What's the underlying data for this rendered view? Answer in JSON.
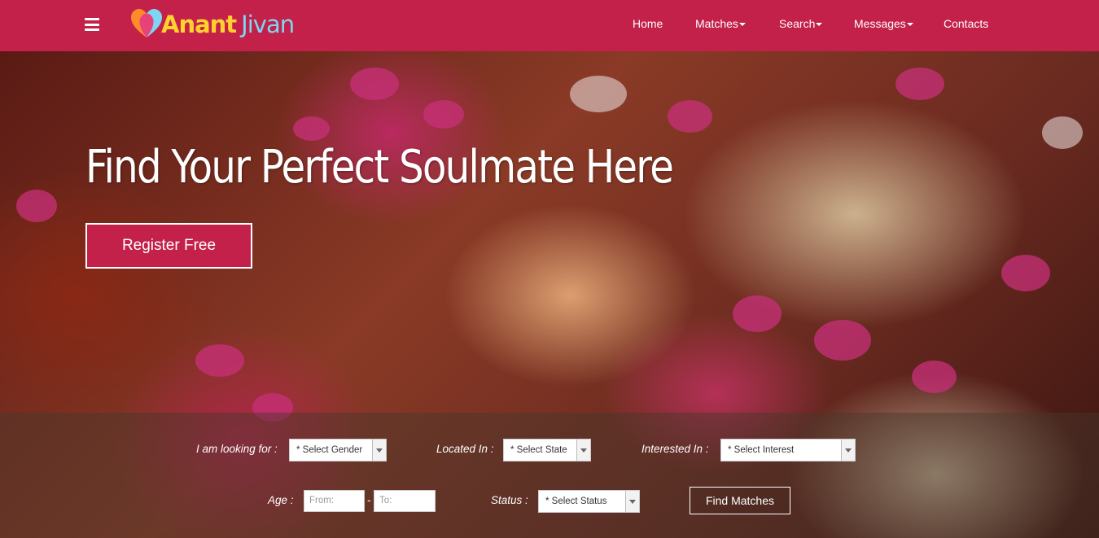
{
  "brand": {
    "part1": "Anant",
    "part2": "Jivan"
  },
  "nav": {
    "home": "Home",
    "matches": "Matches",
    "search": "Search",
    "messages": "Messages",
    "contacts": "Contacts"
  },
  "hero": {
    "title": "Find Your Perfect Soulmate Here",
    "register_label": "Register Free"
  },
  "search": {
    "looking_for_label": "I am looking for :",
    "gender_value": "* Select Gender",
    "located_label": "Located In :",
    "state_value": "* Select State",
    "interest_label": "Interested In :",
    "interest_value": "* Select Interest",
    "age_label": "Age :",
    "age_from_placeholder": "From:",
    "age_separator": "-",
    "age_to_placeholder": "To:",
    "status_label": "Status :",
    "status_value": "* Select Status",
    "find_label": "Find Matches"
  },
  "colors": {
    "brand_primary": "#c3204a",
    "logo_yellow": "#ffd22e",
    "logo_blue": "#7fd6f2"
  },
  "icons": {
    "menu": "hamburger-icon",
    "logo": "heart-logo-icon",
    "dropdown": "caret-down-icon"
  }
}
